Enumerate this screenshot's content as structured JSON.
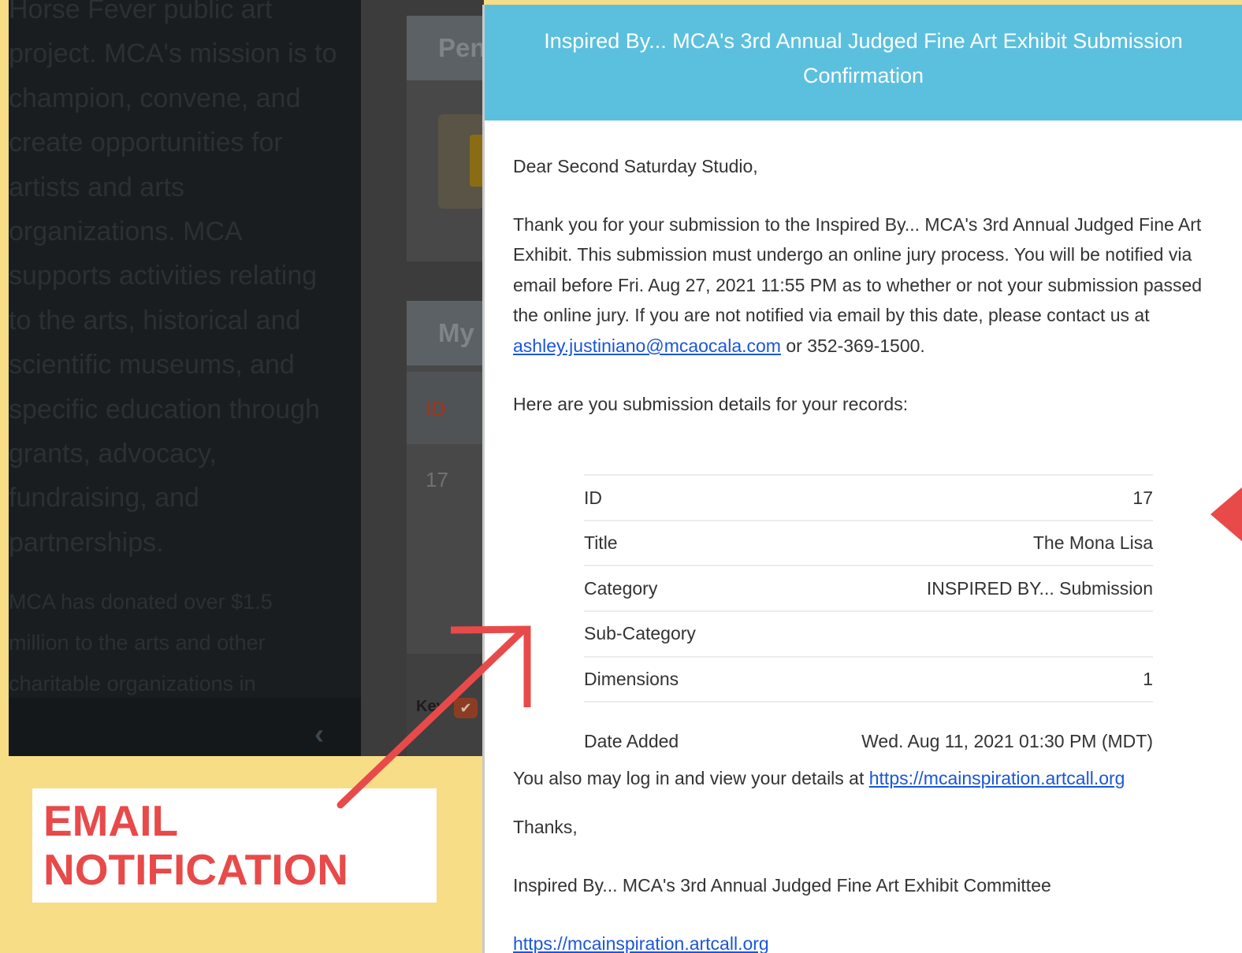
{
  "background_page": {
    "about_lines": [
      "Horse Fever public art",
      "project. MCA's mission is to",
      "champion, convene, and",
      "create opportunities for",
      "artists and arts",
      "organizations. MCA",
      "supports activities relating",
      "to the arts, historical and",
      "scientific museums, and",
      "specific education through",
      "grants, advocacy,",
      "fundraising, and",
      "partnerships."
    ],
    "donated_lines": [
      "MCA has donated over $1.5",
      "million to the arts and other",
      "charitable organizations in"
    ],
    "pending_panel_title": "Pen",
    "my_panel_title": "My",
    "id_header": "ID",
    "id_cell": "17",
    "key_label": "Key",
    "collapse_glyph": "‹",
    "key_check_glyph": "✔"
  },
  "email": {
    "header_title": "Inspired By... MCA's 3rd Annual Judged Fine Art Exhibit Submission Confirmation",
    "greeting": "Dear Second Saturday Studio,",
    "para_before_email": "Thank you for your submission to the Inspired By... MCA's 3rd Annual Judged Fine Art Exhibit. This submission must undergo an online jury process. You will be notified via email before Fri. Aug 27, 2021 11:55 PM as to whether or not your submission passed the online jury. If you are not notified via email by this date, please contact us at ",
    "contact_email": "ashley.justiniano@mcaocala.com",
    "para_after_email": " or 352-369-1500.",
    "details_intro": "Here are you submission details for your records:",
    "details": [
      {
        "label": "ID",
        "value": "17"
      },
      {
        "label": "Title",
        "value": "The Mona Lisa"
      },
      {
        "label": "Category",
        "value": "INSPIRED BY... Submission"
      },
      {
        "label": "Sub-Category",
        "value": ""
      },
      {
        "label": "Dimensions",
        "value": "1"
      },
      {
        "label": "Date Added",
        "value": "Wed. Aug 11, 2021 01:30 PM (MDT)"
      }
    ],
    "also_text": "You also may log in and view your details at ",
    "site_link": "https://mcainspiration.artcall.org",
    "thanks": "Thanks,",
    "signature": "Inspired By... MCA's 3rd Annual Judged Fine Art Exhibit Committee",
    "footer_link": "https://mcainspiration.artcall.org"
  },
  "annotation": {
    "label_line1": "EMAIL",
    "label_line2": "NOTIFICATION",
    "accent_color": "#e84a4a",
    "backdrop_color": "#f6dd86",
    "header_color": "#5bc0de"
  }
}
